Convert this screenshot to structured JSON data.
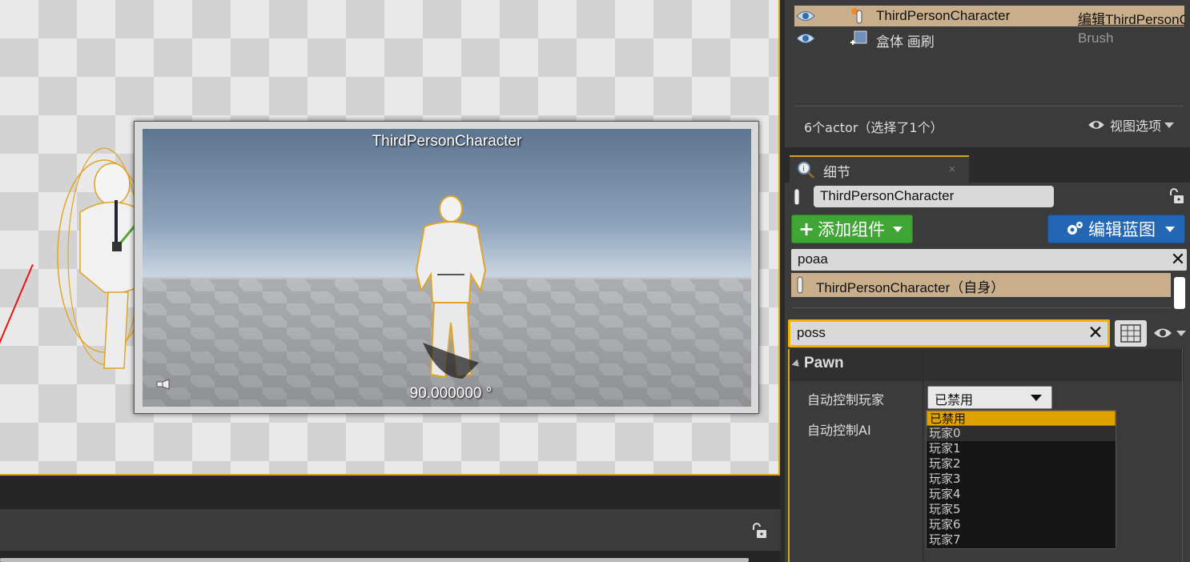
{
  "viewport": {
    "preview_title": "ThirdPersonCharacter",
    "preview_angle": "90.000000 °"
  },
  "outliner": {
    "rows": [
      {
        "name": "ThirdPersonCharacter",
        "type": "编辑ThirdPersonCharacter",
        "selected": true,
        "icon": "pawn-icon"
      },
      {
        "name": "盒体 画刷",
        "type": "Brush",
        "selected": false,
        "icon": "brush-icon"
      }
    ],
    "count_text": "6个actor（选择了1个）",
    "view_options": "视图选项"
  },
  "details": {
    "tab_label": "细节",
    "tab_close": "×",
    "actor_name": "ThirdPersonCharacter",
    "add_component": "添加组件",
    "edit_blueprint": "编辑蓝图",
    "component_search": "poaa",
    "component_row": "ThirdPersonCharacter（自身）",
    "property_search": "poss",
    "category": "Pawn",
    "properties": [
      {
        "name": "自动控制玩家",
        "value": "已禁用"
      },
      {
        "name": "自动控制AI",
        "value": ""
      }
    ],
    "dropdown_options": [
      "已禁用",
      "玩家0",
      "玩家1",
      "玩家2",
      "玩家3",
      "玩家4",
      "玩家5",
      "玩家6",
      "玩家7"
    ]
  },
  "colors": {
    "selection": "#c9ae8b",
    "accent": "#d8a523",
    "add_green": "#3fa535",
    "blueprint_blue": "#2366b4",
    "dropdown_selected": "#e0a200"
  }
}
